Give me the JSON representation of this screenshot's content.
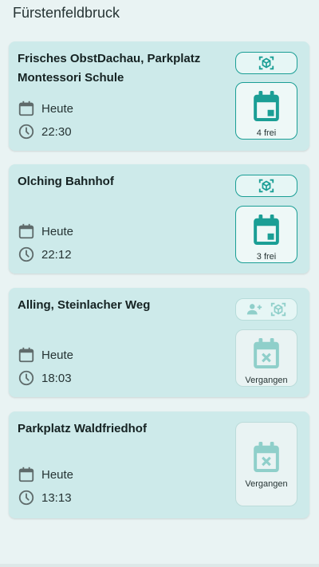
{
  "header": {
    "title": "Fürstenfeldbruck"
  },
  "colors": {
    "accent": "#1a9e95",
    "card": "#cdeaea",
    "background": "#e9f3f3"
  },
  "cards": [
    {
      "title": "Frisches ObstDachau, Parkplatz Montessori Schule",
      "day": "Heute",
      "time": "22:30",
      "status": "4 frei"
    },
    {
      "title": "Olching Bahnhof",
      "day": "Heute",
      "time": "22:12",
      "status": "3 frei"
    },
    {
      "title": "Alling, Steinlacher Weg",
      "day": "Heute",
      "time": "18:03",
      "status": "Vergangen"
    },
    {
      "title": "Parkplatz Waldfriedhof",
      "day": "Heute",
      "time": "13:13",
      "status": "Vergangen"
    }
  ]
}
